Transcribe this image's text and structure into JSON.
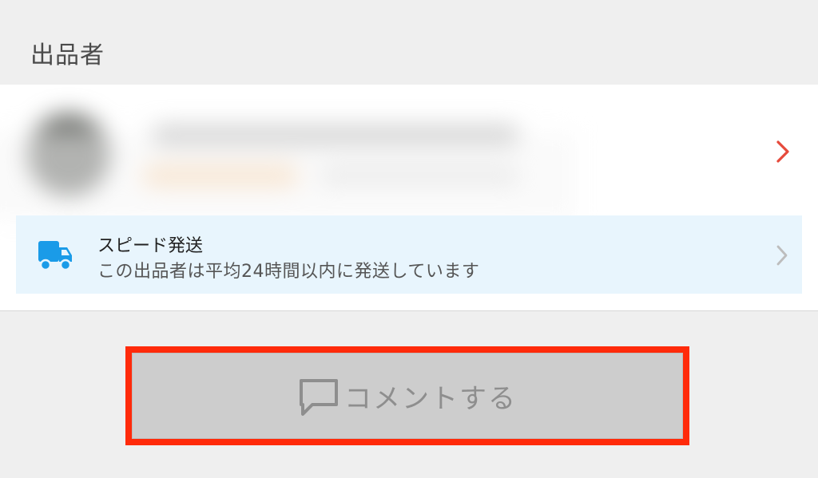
{
  "section": {
    "title": "出品者"
  },
  "seller": {
    "chevron_icon": "chevron-right-icon",
    "chevron_color": "#e64a3b"
  },
  "speed_shipping": {
    "icon": "truck-icon",
    "icon_color": "#1a9be8",
    "title": "スピード発送",
    "description": "この出品者は平均24時間以内に発送しています",
    "chevron_icon": "chevron-right-icon"
  },
  "comment_button": {
    "icon": "comment-bubble-icon",
    "label": "コメントする"
  },
  "colors": {
    "highlight": "#ff2a0a",
    "banner_background": "#e8f5fd",
    "page_background": "#efefef"
  }
}
